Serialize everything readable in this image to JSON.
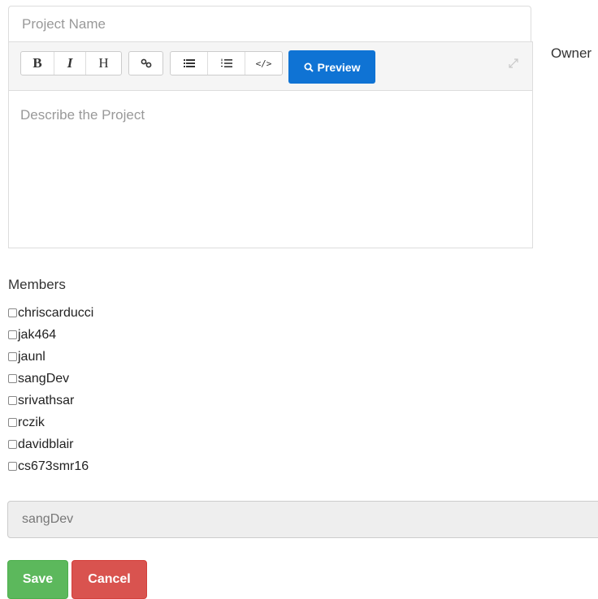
{
  "form": {
    "project_name_placeholder": "Project Name",
    "owner_label": "Owner",
    "members_label": "Members",
    "owner_value": "sangDev",
    "save_label": "Save",
    "cancel_label": "Cancel"
  },
  "editor": {
    "placeholder": "Describe the Project",
    "toolbar": {
      "bold": "B",
      "italic": "I",
      "heading": "H",
      "link_icon": "link-icon",
      "unordered_list_icon": "unordered-list-icon",
      "ordered_list_icon": "ordered-list-icon",
      "code": "</>",
      "preview_label": "Preview",
      "preview_icon": "search-icon",
      "fullscreen_icon": "expand-icon"
    }
  },
  "members": [
    {
      "name": "chriscarducci",
      "checked": false
    },
    {
      "name": "jak464",
      "checked": false
    },
    {
      "name": "jaunl",
      "checked": false
    },
    {
      "name": "sangDev",
      "checked": false
    },
    {
      "name": "srivathsar",
      "checked": false
    },
    {
      "name": "rczik",
      "checked": false
    },
    {
      "name": "davidblair",
      "checked": false
    },
    {
      "name": "cs673smr16",
      "checked": false
    }
  ],
  "colors": {
    "preview": "#0f73d4",
    "save": "#5cb85c",
    "cancel": "#d9534f"
  }
}
